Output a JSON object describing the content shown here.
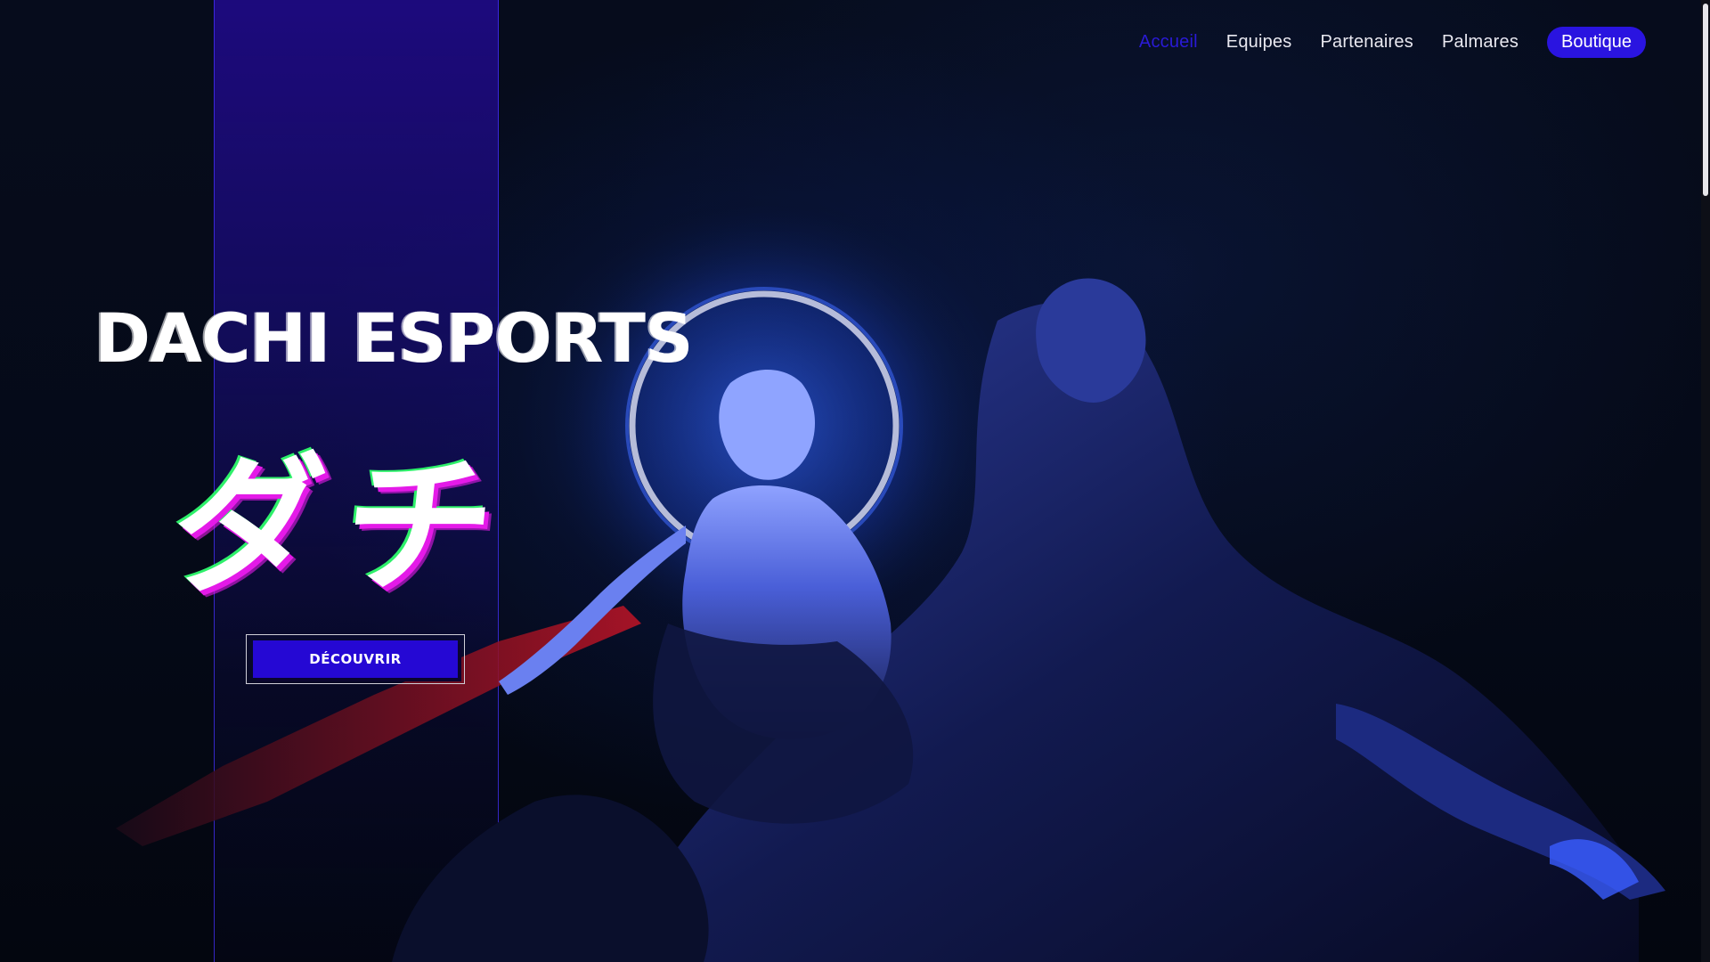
{
  "nav": {
    "items": [
      {
        "label": "Accueil",
        "active": true
      },
      {
        "label": "Equipes",
        "active": false
      },
      {
        "label": "Partenaires",
        "active": false
      },
      {
        "label": "Palmares",
        "active": false
      }
    ],
    "shop_label": "Boutique"
  },
  "hero": {
    "title": "DACHI ESPORTS",
    "kana": "ダチ",
    "cta_label": "DÉCOUVRIR"
  },
  "colors": {
    "accent": "#2a14e0",
    "active_link": "#2a1ad6",
    "stripe": "#1e0a82",
    "glitch_magenta": "#e41ae8",
    "glitch_green": "#2ef06a",
    "background": "#060c1c"
  }
}
